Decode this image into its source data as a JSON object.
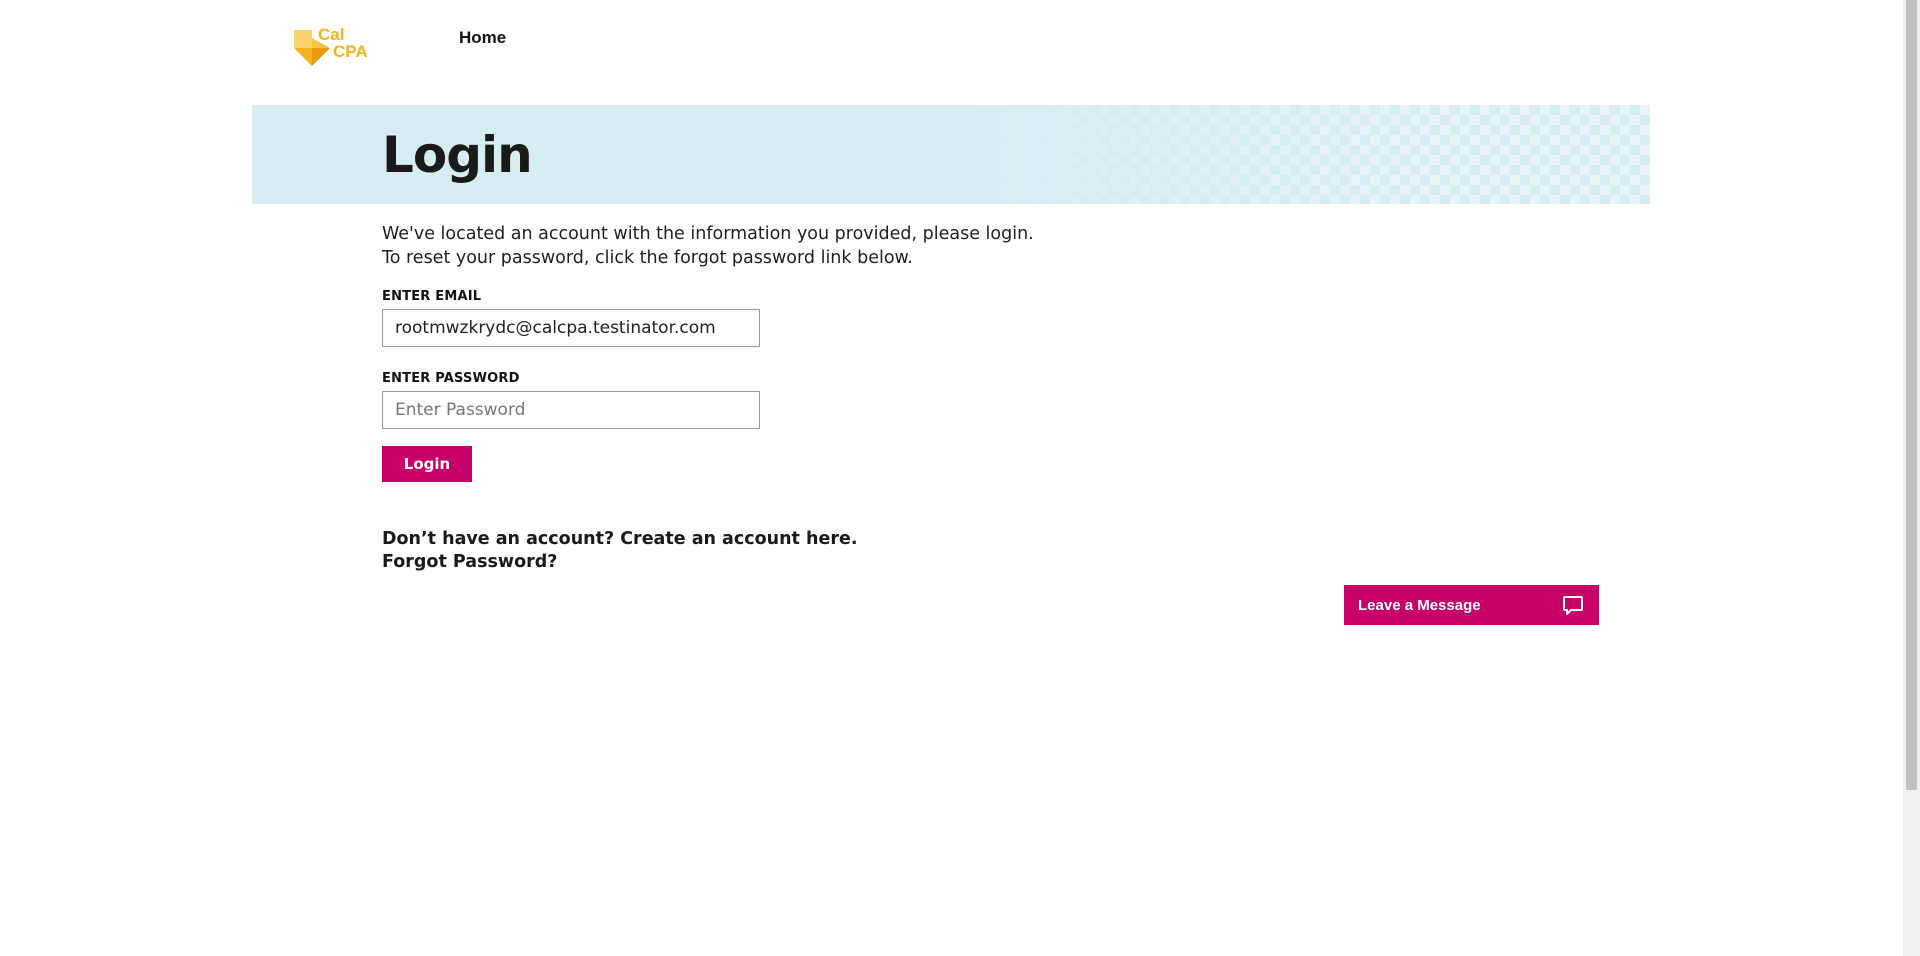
{
  "header": {
    "logo_line1": "Cal",
    "logo_line2": "CPA",
    "nav_home": "Home"
  },
  "banner": {
    "title": "Login"
  },
  "form": {
    "intro": "We've located an account with the information you provided, please login. To reset your password, click the forgot password link below.",
    "email_label": "ENTER EMAIL",
    "email_value": "rootmwzkrydc@calcpa.testinator.com",
    "password_label": "ENTER PASSWORD",
    "password_placeholder": "Enter Password",
    "login_label": "Login"
  },
  "links": {
    "create_account": "Don’t have an account? Create an account here.",
    "forgot_password": "Forgot Password?"
  },
  "widget": {
    "leave_message": "Leave a Message",
    "icon": "chat-bubble-icon"
  },
  "colors": {
    "accent": "#c8006a",
    "logo": "#f5b419",
    "banner": "#d6edf1"
  }
}
